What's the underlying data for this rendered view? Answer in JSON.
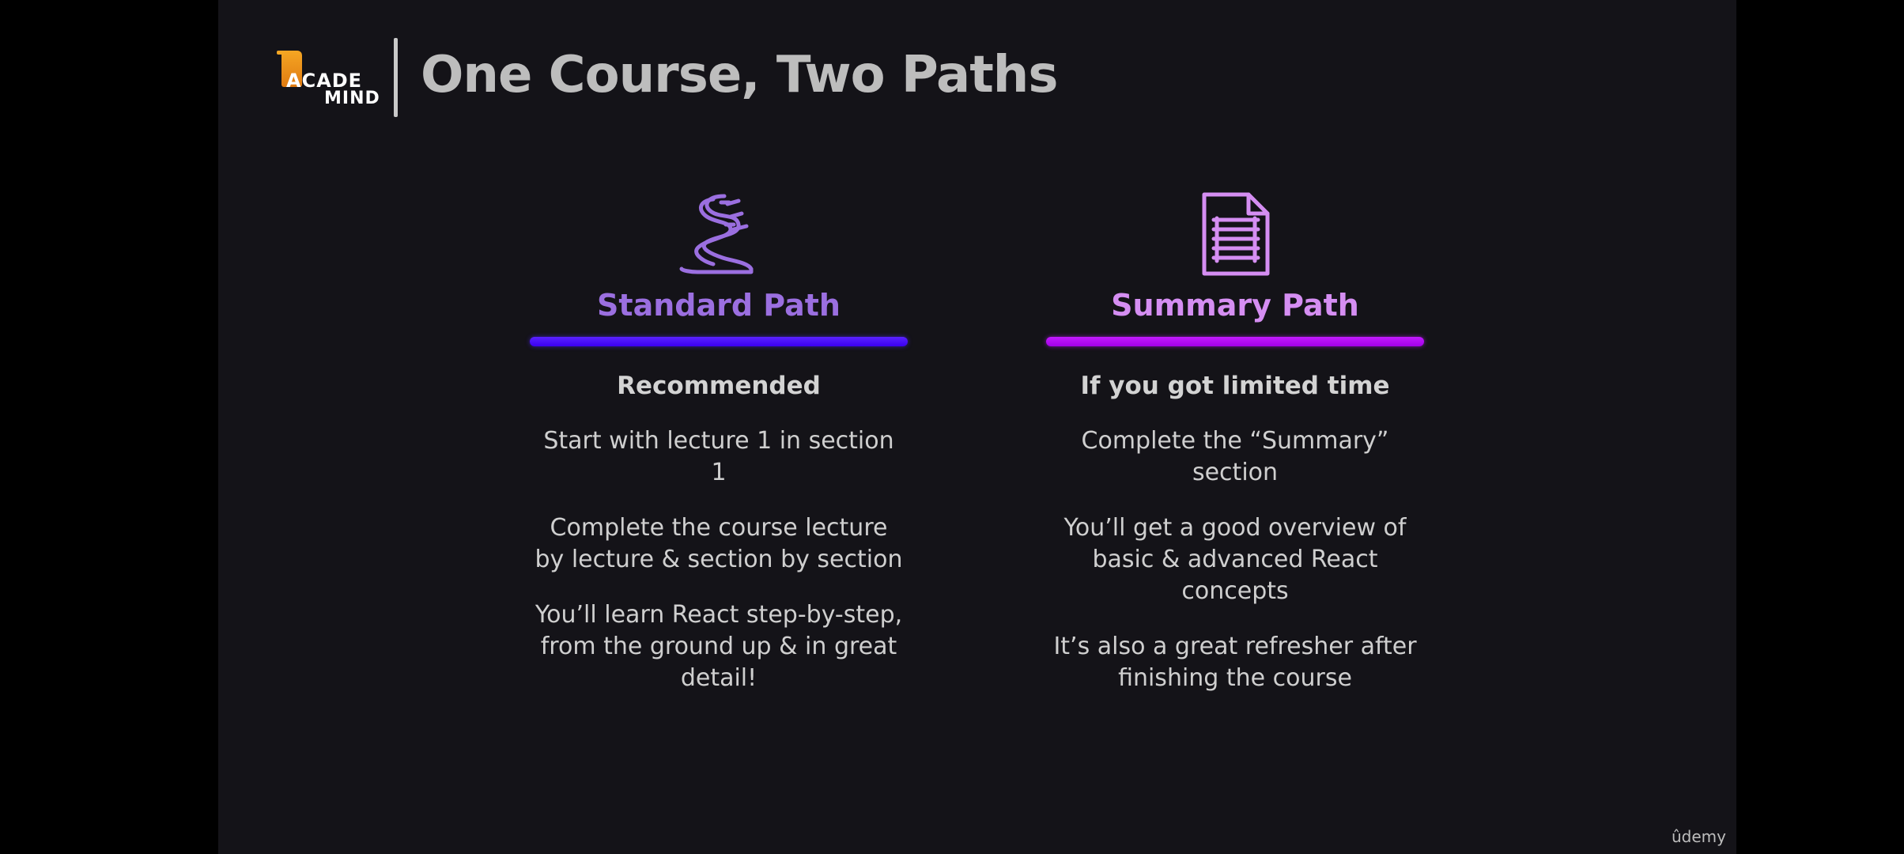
{
  "header": {
    "logo_line1": "ACADE",
    "logo_line2": "MIND",
    "title": "One Course, Two Paths"
  },
  "paths": [
    {
      "icon": "winding-road-icon",
      "title": "Standard Path",
      "subtitle": "Recommended",
      "points": [
        "Start with lecture 1 in section 1",
        "Complete the course lecture by lecture & section by section",
        "You’ll learn React step-by-step, from the ground up & in great detail!"
      ],
      "accent_color": "#9b6fe0",
      "underline_color": "#3a00f0"
    },
    {
      "icon": "document-icon",
      "title": "Summary Path",
      "subtitle": "If you got limited time",
      "points": [
        "Complete the “Summary” section",
        "You’ll get a good overview of basic & advanced React concepts",
        "It’s also a great refresher after finishing the course"
      ],
      "accent_color": "#d58ef2",
      "underline_color": "#b10cf5"
    }
  ],
  "watermark": "ûdemy",
  "colors": {
    "slide_background": "#141318",
    "logo_orange": "#f5a623",
    "title_gray": "#bdbdbd"
  }
}
